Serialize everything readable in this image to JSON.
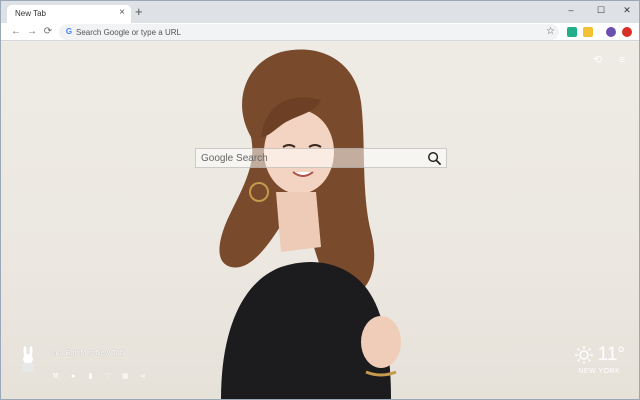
{
  "tab": {
    "title": "New Tab",
    "close": "×",
    "new_tab": "+"
  },
  "window": {
    "minimize": "–",
    "maximize": "☐",
    "close": "✕"
  },
  "toolbar": {
    "back": "←",
    "forward": "→",
    "reload": "⟳",
    "omnibox_placeholder": "Search Google or type a URL",
    "bookmark": "☆"
  },
  "page": {
    "search_placeholder": "Google Search",
    "brand_text": "In a Eat' Me* New Tab",
    "weather": {
      "temp": "11°",
      "city": "NEW YORK"
    }
  },
  "colors": {
    "accent": "#4285f4",
    "tabstrip": "#dee1e6"
  }
}
